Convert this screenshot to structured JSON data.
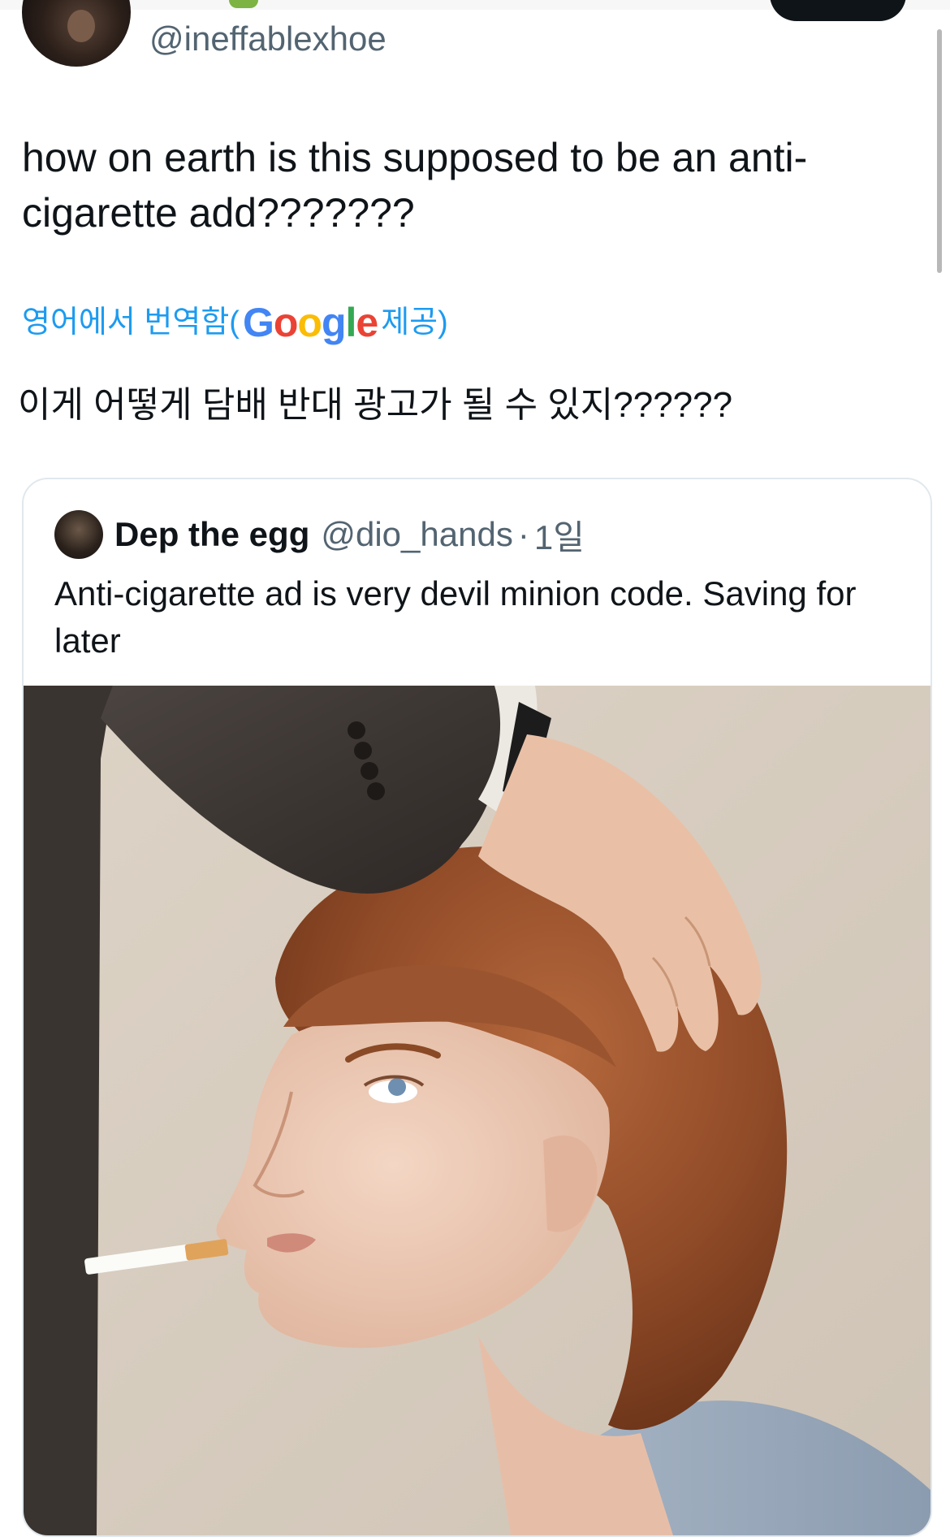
{
  "author": {
    "handle": "@ineffablexhoe",
    "avatar_icon": "profile-photo",
    "verified_badge_color": "#7cb342"
  },
  "tweet": {
    "text": "how on earth is this supposed to be an anti-\ncigarette add???????",
    "translation_prefix": "영어에서 번역함(",
    "translation_provider": "Google",
    "translation_suffix": " 제공)",
    "translated_text": "이게 어떻게 담배 반대 광고가 될 수 있지??????"
  },
  "quoted_tweet": {
    "name": "Dep the egg",
    "handle": "@dio_hands",
    "separator": "·",
    "time": "1일",
    "text": "Anti-cigarette ad is very devil minion code. Saving for later",
    "media_icon": "photo-boy-with-cigarette"
  },
  "colors": {
    "link_blue": "#1d9bf0",
    "secondary_text": "#536471",
    "primary_text": "#0f1419",
    "card_border": "#e1e8ed",
    "follow_button": "#0f1419"
  }
}
